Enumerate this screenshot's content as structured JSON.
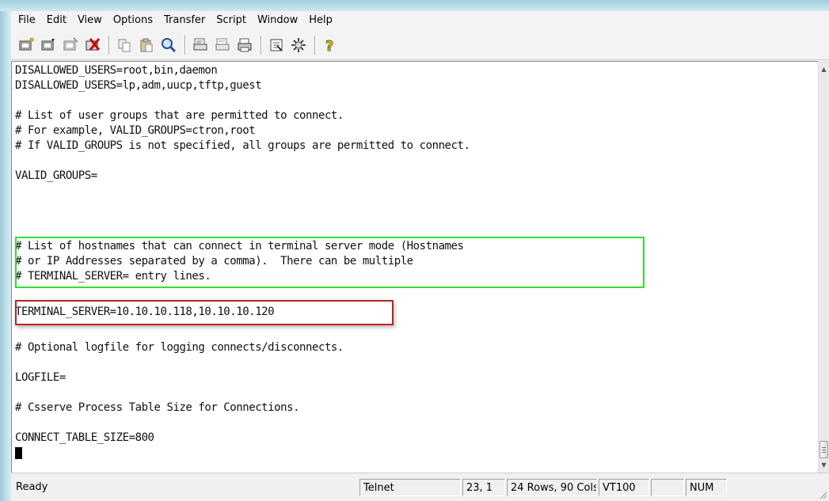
{
  "menu": {
    "items": [
      "File",
      "Edit",
      "View",
      "Options",
      "Transfer",
      "Script",
      "Window",
      "Help"
    ]
  },
  "toolbar": {
    "buttons": [
      "connect-icon",
      "quick-connect-icon",
      "connect-in-tab-icon",
      "disconnect-icon",
      "copy-icon",
      "paste-icon",
      "find-icon",
      "print-setup-icon",
      "print-selection-icon",
      "print-icon",
      "session-options-icon",
      "global-options-icon",
      "help-icon"
    ]
  },
  "terminal": {
    "lines": [
      "DISALLOWED_USERS=root,bin,daemon",
      "DISALLOWED_USERS=lp,adm,uucp,tftp,guest",
      "",
      "# List of user groups that are permitted to connect.",
      "# For example, VALID_GROUPS=ctron,root",
      "# If VALID_GROUPS is not specified, all groups are permitted to connect.",
      "",
      "VALID_GROUPS=",
      "",
      "# List of hostnames that can connect in terminal server mode (Hostnames",
      "# or IP Addresses separated by a comma).  There can be multiple",
      "# TERMINAL_SERVER= entry lines.",
      "",
      "TERMINAL_SERVER=10.10.10.118,10.10.10.120",
      "",
      "# Optional logfile for logging connects/disconnects.",
      "",
      "LOGFILE=",
      "",
      "# Csserve Process Table Size for Connections.",
      "",
      "CONNECT_TABLE_SIZE=800"
    ],
    "highlight_green_color": "#33dd33",
    "highlight_red_color": "#b52424"
  },
  "status": {
    "state": "Ready",
    "protocol": "Telnet",
    "cursor_pos": "23,  1",
    "dimensions": "24 Rows, 90 Cols",
    "emulation": "VT100",
    "blank": "",
    "num": "NUM"
  }
}
